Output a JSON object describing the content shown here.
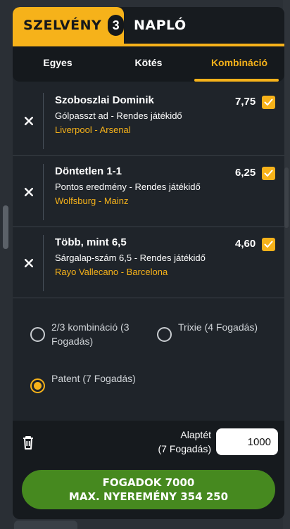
{
  "tabs": {
    "szelveny_label": "SZELVÉNY",
    "szelveny_count": "3",
    "naplo_label": "NAPLÓ"
  },
  "subtabs": {
    "egyes": "Egyes",
    "kotes": "Kötés",
    "kombinacio": "Kombináció",
    "active": "Kombináció"
  },
  "bets": [
    {
      "title": "Szoboszlai Dominik",
      "market": "Gólpasszt ad - Rendes játékidő",
      "match": "Liverpool - Arsenal",
      "odds": "7,75",
      "checked": true
    },
    {
      "title": "Döntetlen 1-1",
      "market": "Pontos eredmény - Rendes játékidő",
      "match": "Wolfsburg - Mainz",
      "odds": "6,25",
      "checked": true
    },
    {
      "title": "Több, mint 6,5",
      "market": "Sárgalap-szám 6,5 - Rendes játékidő",
      "match": "Rayo Vallecano - Barcelona",
      "odds": "4,60",
      "checked": true
    }
  ],
  "options": [
    {
      "label": "2/3 kombináció (3 Fogadás)",
      "selected": false
    },
    {
      "label": "Trixie (4 Fogadás)",
      "selected": false
    },
    {
      "label": "Patent (7 Fogadás)",
      "selected": true
    }
  ],
  "stake": {
    "label_line1": "Alaptét",
    "label_line2": "(7 Fogadás)",
    "value": "1000"
  },
  "submit": {
    "line1": "FOGADOK 7000",
    "line2": "MAX. NYEREMÉNY 354 250"
  },
  "colors": {
    "accent": "#f6b21a",
    "submit_green": "#46891f",
    "panel": "#1f242a"
  }
}
